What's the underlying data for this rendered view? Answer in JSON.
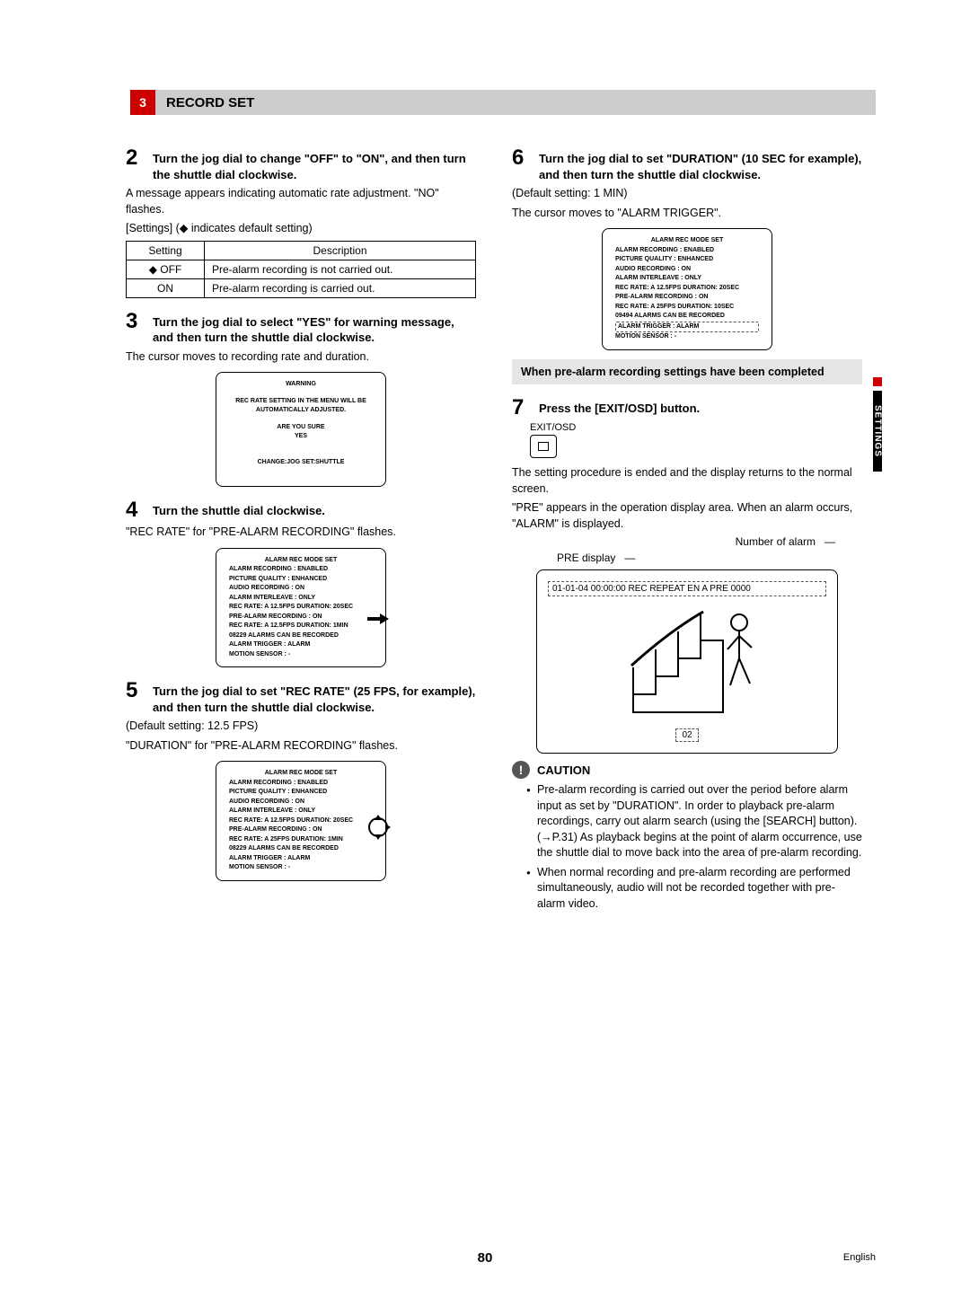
{
  "header": {
    "section_number": "3",
    "title": "RECORD SET"
  },
  "left": {
    "step2": {
      "num": "2",
      "title": "Turn the jog dial to change \"OFF\" to \"ON\", and then turn the shuttle dial clockwise.",
      "body1": "A message appears indicating automatic rate adjustment. \"NO\" flashes.",
      "settings_note": "[Settings] (◆ indicates default setting)",
      "table": {
        "h1": "Setting",
        "h2": "Description",
        "r1c1": "◆ OFF",
        "r1c2": "Pre-alarm recording is not carried out.",
        "r2c1": "ON",
        "r2c2": "Pre-alarm recording is carried out."
      }
    },
    "step3": {
      "num": "3",
      "title": "Turn the jog dial to select \"YES\" for warning message, and then turn the shuttle dial clockwise.",
      "body1": "The cursor moves to recording rate and duration.",
      "osd": {
        "l1": "WARNING",
        "l2": "REC RATE SETTING IN THE MENU WILL BE",
        "l3": "AUTOMATICALLY ADJUSTED.",
        "l4": "ARE YOU SURE",
        "l5": "YES",
        "l6": "CHANGE:JOG  SET:SHUTTLE"
      }
    },
    "step4": {
      "num": "4",
      "title": "Turn the shuttle dial clockwise.",
      "body1": "\"REC RATE\" for \"PRE-ALARM RECORDING\" flashes.",
      "osd": {
        "l1": "ALARM REC MODE SET",
        "l2": "ALARM RECORDING      : ENABLED",
        "l3": "PICTURE QUALITY      : ENHANCED",
        "l4": "AUDIO RECORDING      : ON",
        "l5": "ALARM INTERLEAVE     : ONLY",
        "l6": "REC RATE: A 12.5FPS    DURATION: 20SEC",
        "l7": "PRE-ALARM RECORDING  : ON",
        "l8": "REC RATE: A 12.5FPS   DURATION: 1MIN",
        "l9": "08229 ALARMS CAN BE RECORDED",
        "l10": "ALARM TRIGGER        : ALARM",
        "l11": "MOTION SENSOR        : -"
      }
    },
    "step5": {
      "num": "5",
      "title": "Turn the jog dial to set \"REC RATE\" (25 FPS, for example), and then turn the shuttle dial clockwise.",
      "body1": "(Default setting: 12.5 FPS)",
      "body2": "\"DURATION\" for \"PRE-ALARM RECORDING\" flashes.",
      "osd": {
        "l1": "ALARM REC MODE SET",
        "l2": "ALARM RECORDING      : ENABLED",
        "l3": "PICTURE QUALITY      : ENHANCED",
        "l4": "AUDIO RECORDING      : ON",
        "l5": "ALARM INTERLEAVE     : ONLY",
        "l6": "REC RATE: A 12.5FPS    DURATION: 20SEC",
        "l7": "PRE-ALARM RECORDING  : ON",
        "l8": "REC RATE: A  25FPS    DURATION: 1MIN",
        "l9": "08229 ALARMS CAN BE RECORDED",
        "l10": "ALARM TRIGGER        : ALARM",
        "l11": "MOTION SENSOR        : -"
      }
    }
  },
  "right": {
    "step6": {
      "num": "6",
      "title": "Turn the jog dial to set \"DURATION\" (10 SEC for example), and then turn the shuttle dial clockwise.",
      "body1": "(Default setting: 1 MIN)",
      "body2": "The cursor moves to \"ALARM TRIGGER\".",
      "osd": {
        "l1": "ALARM REC MODE SET",
        "l2": "ALARM RECORDING      : ENABLED",
        "l3": "PICTURE QUALITY      : ENHANCED",
        "l4": "AUDIO RECORDING      : ON",
        "l5": "ALARM INTERLEAVE     : ONLY",
        "l6": "REC RATE: A 12.5FPS    DURATION: 20SEC",
        "l7": "PRE-ALARM RECORDING  : ON",
        "l8": "REC RATE: A  25FPS    DURATION: 10SEC",
        "l9": "09494 ALARMS CAN BE RECORDED",
        "l10": "ALARM TRIGGER        : ALARM",
        "l11": "MOTION SENSOR        : -"
      }
    },
    "completed_box": "When pre-alarm recording settings have been completed",
    "step7": {
      "num": "7",
      "title": "Press the [EXIT/OSD] button.",
      "exit_label": "EXIT/OSD",
      "body1": "The setting procedure is ended and the display returns to the normal screen.",
      "body2": "\"PRE\" appears in the operation display area. When an alarm occurs, \"ALARM\" is displayed.",
      "fig": {
        "num_label": "Number of alarm",
        "pre_label": "PRE display",
        "status_line": "01-01-04 00:00:00 REC REPEAT EN A   PRE   0000",
        "count": "02"
      }
    },
    "caution": {
      "title": "CAUTION",
      "b1": "Pre-alarm recording is carried out over the period before alarm input as set by \"DURATION\". In order to playback pre-alarm recordings, carry out alarm search (using the [SEARCH] button). (→P.31)\nAs playback begins at the point of alarm occurrence, use the shuttle dial to move back into the area of pre-alarm recording.",
      "b2": "When normal recording and pre-alarm recording are performed simultaneously, audio will not be recorded together with pre-alarm video."
    }
  },
  "side_tab": "SETTINGS",
  "page_number": "80",
  "language": "English"
}
